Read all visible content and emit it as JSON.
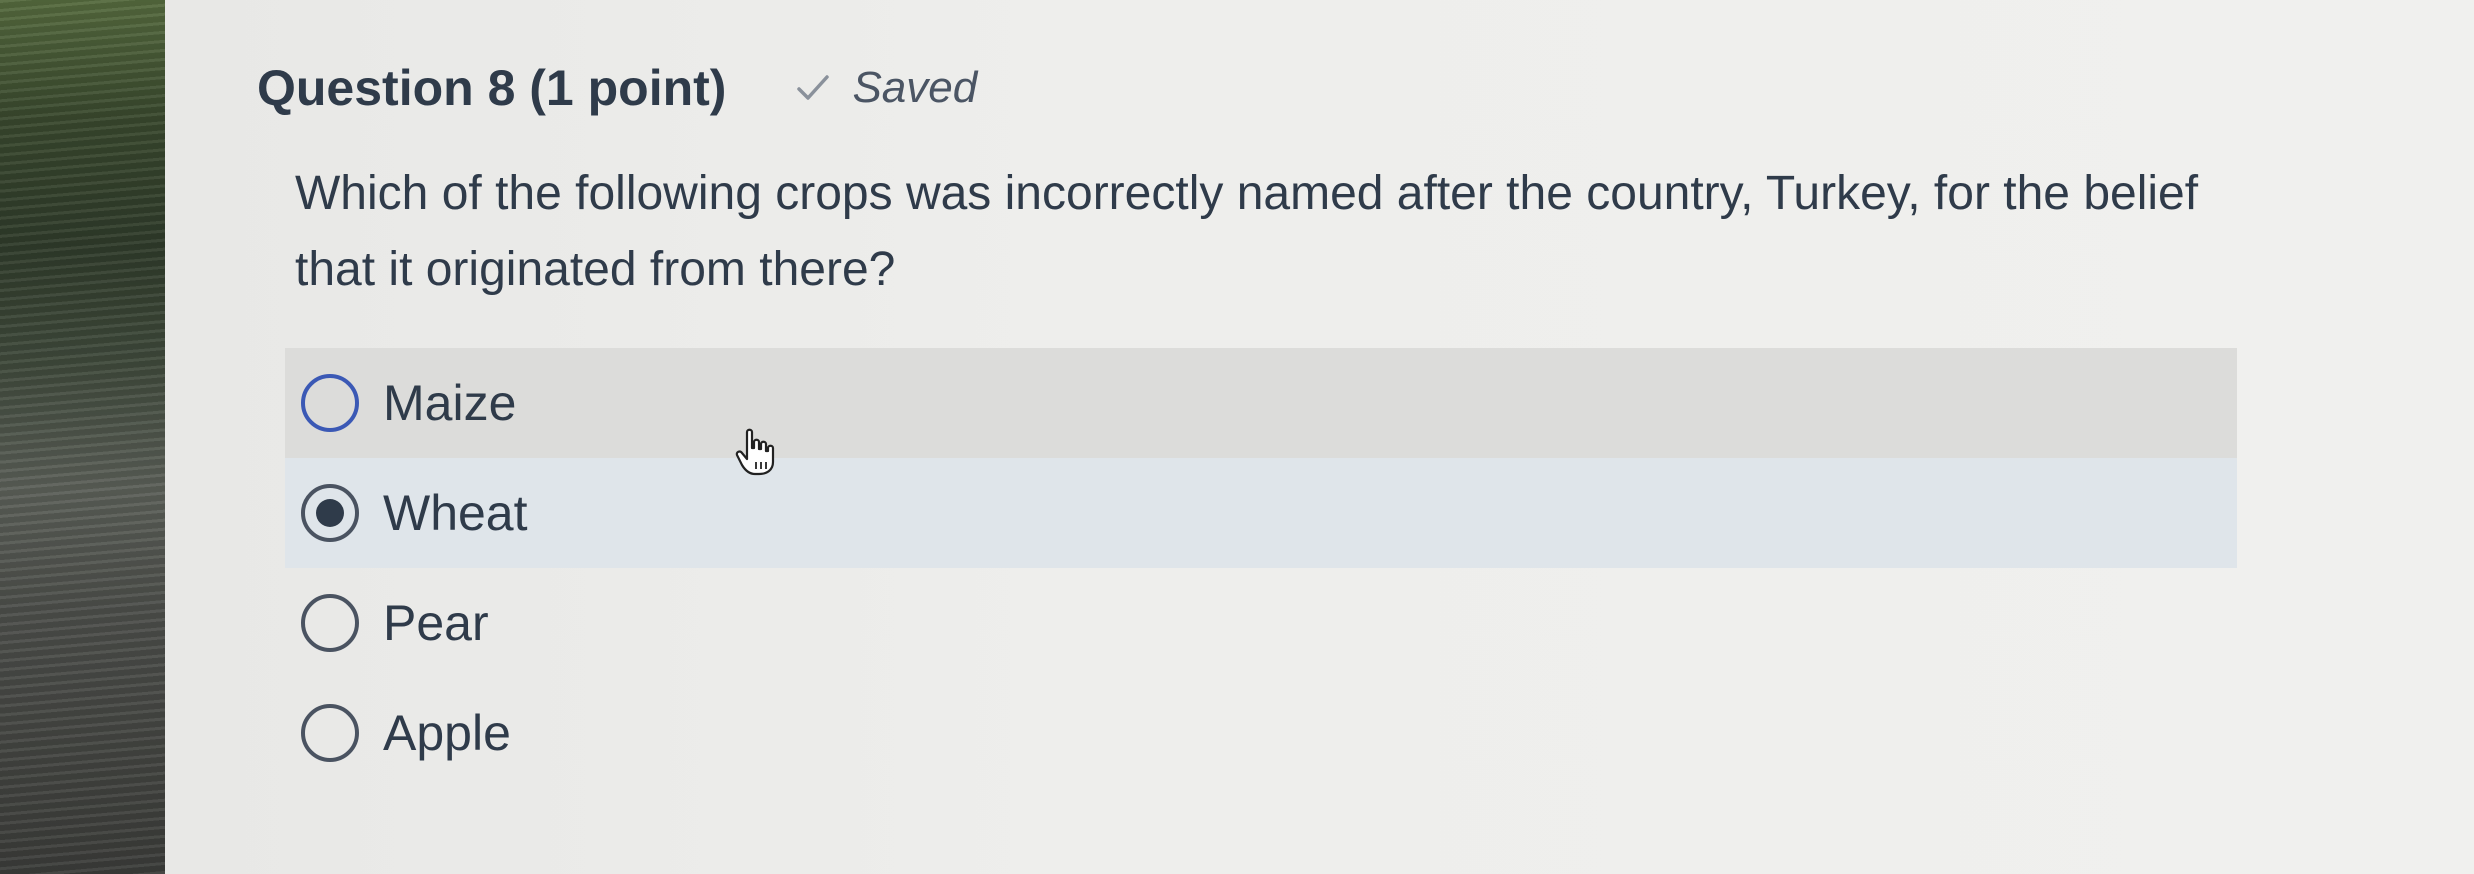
{
  "question": {
    "title": "Question 8 (1 point)",
    "status": "Saved",
    "status_icon": "check-icon",
    "text": "Which of the following crops was incorrectly named after the country, Turkey, for the belief that it originated from there?"
  },
  "options": [
    {
      "label": "Maize",
      "selected": false,
      "hovered": true
    },
    {
      "label": "Wheat",
      "selected": true,
      "hovered": false
    },
    {
      "label": "Pear",
      "selected": false,
      "hovered": false
    },
    {
      "label": "Apple",
      "selected": false,
      "hovered": false
    }
  ],
  "colors": {
    "text": "#2f3b4a",
    "hover_row": "#dcdcda",
    "selected_row": "#dfe5ea",
    "focus_ring": "#3b59b5"
  },
  "cursor": "hand-pointer-icon"
}
